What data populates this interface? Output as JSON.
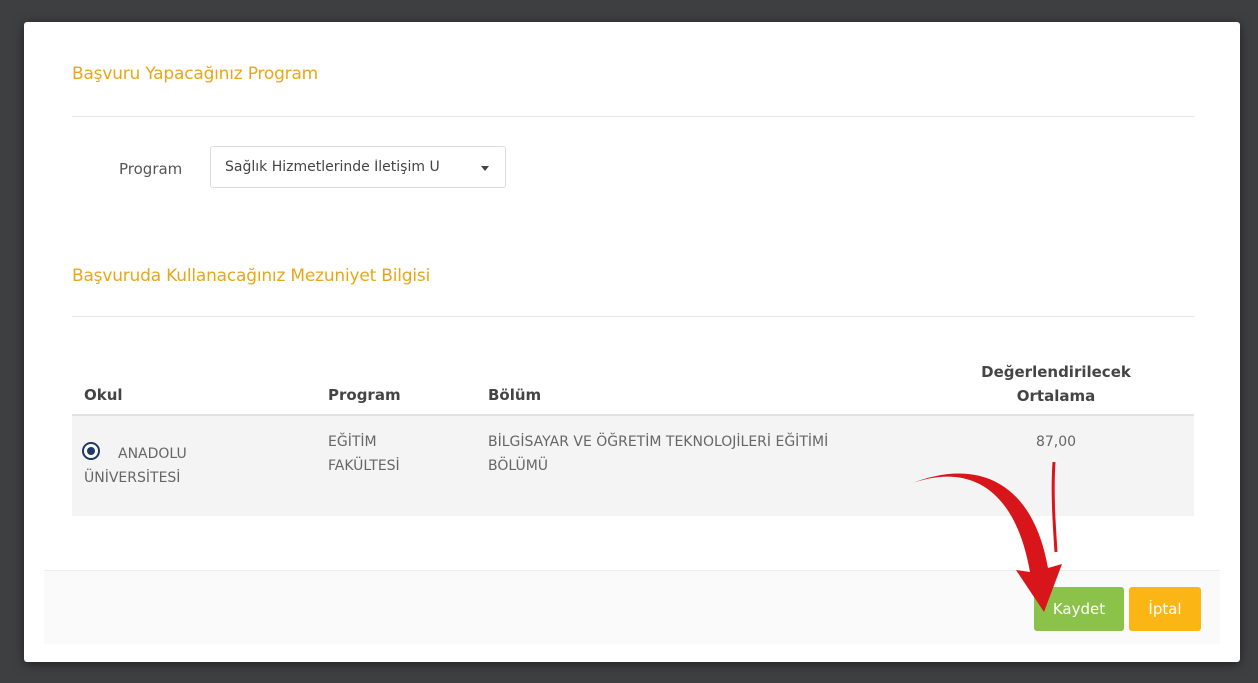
{
  "program_section": {
    "title": "Başvuru Yapacağınız Program",
    "label": "Program",
    "selected_value": "Sağlık Hizmetlerinde İletişim U"
  },
  "graduation_section": {
    "title": "Başvuruda Kullanacağınız Mezuniyet Bilgisi"
  },
  "table": {
    "headers": {
      "school": "Okul",
      "program": "Program",
      "department": "Bölüm",
      "average_line1": "Değerlendirilecek",
      "average_line2": "Ortalama"
    },
    "rows": [
      {
        "school_line1": "ANADOLU",
        "school_line2": "ÜNİVERSİTESİ",
        "program_line1": "EĞİTİM",
        "program_line2": "FAKÜLTESİ",
        "department_line1": "BİLGİSAYAR VE ÖĞRETİM TEKNOLOJİLERİ EĞİTİMİ",
        "department_line2": "BÖLÜMÜ",
        "average": "87,00",
        "selected": true
      }
    ]
  },
  "footer": {
    "save_label": "Kaydet",
    "cancel_label": "İptal"
  },
  "colors": {
    "accent": "#e8a71a",
    "save": "#8bc34a",
    "cancel": "#fbb515",
    "arrow": "#d8151b"
  },
  "icons": {
    "select_caret": "caret-down-icon",
    "annotation": "red-arrow-icon"
  }
}
